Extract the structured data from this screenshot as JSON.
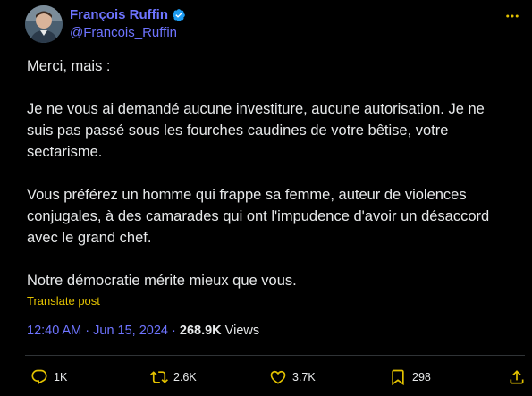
{
  "author": {
    "display_name": "François Ruffin",
    "handle": "@Francois_Ruffin",
    "verified": true
  },
  "tweet": {
    "paragraphs": [
      "Merci, mais :",
      "Je ne vous ai demandé aucune investiture, aucune autorisation. Je ne suis pas passé sous les fourches caudines de votre bêtise, votre sectarisme.",
      "Vous préférez un homme qui frappe sa femme, auteur de violences conjugales, à des camarades qui ont l'impudence d'avoir un désaccord avec le grand chef.",
      "Notre démocratie mérite mieux que vous."
    ],
    "translate_label": "Translate post",
    "timestamp": "12:40 AM · Jun 15, 2024",
    "separator": " · ",
    "views_count": "268.9K",
    "views_label": " Views"
  },
  "actions": {
    "reply": {
      "icon": "reply-icon",
      "count": "1K"
    },
    "repost": {
      "icon": "repost-icon",
      "count": "2.6K"
    },
    "like": {
      "icon": "heart-icon",
      "count": "3.7K"
    },
    "bookmark": {
      "icon": "bookmark-icon",
      "count": "298"
    },
    "share": {
      "icon": "share-icon"
    }
  },
  "colors": {
    "background": "#000000",
    "text": "#e7e9ea",
    "accent": "#6e74ff",
    "translate": "#e3c200",
    "action_icon": "#e3c200",
    "verified": "#1d9bf0"
  }
}
